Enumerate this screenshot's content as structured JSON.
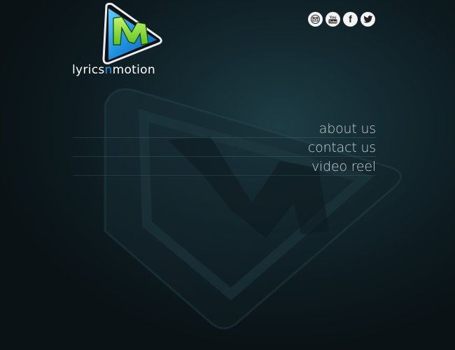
{
  "brand": {
    "name_part1": "lyrics",
    "name_accent": "n",
    "name_part2": "motion",
    "logo_letter": "M",
    "colors": {
      "accent_blue": "#2b9be3",
      "logo_green": "#8fe02a",
      "background": "#0b1418"
    }
  },
  "social": [
    {
      "name": "email",
      "icon": "envelope-icon"
    },
    {
      "name": "youtube",
      "icon": "youtube-icon",
      "label_top": "You",
      "label_bottom": "Tube"
    },
    {
      "name": "facebook",
      "icon": "facebook-icon",
      "glyph": "f"
    },
    {
      "name": "twitter",
      "icon": "twitter-bird-icon"
    }
  ],
  "nav": {
    "items": [
      {
        "label": "about us"
      },
      {
        "label": "contact us"
      },
      {
        "label": "video reel"
      }
    ]
  }
}
